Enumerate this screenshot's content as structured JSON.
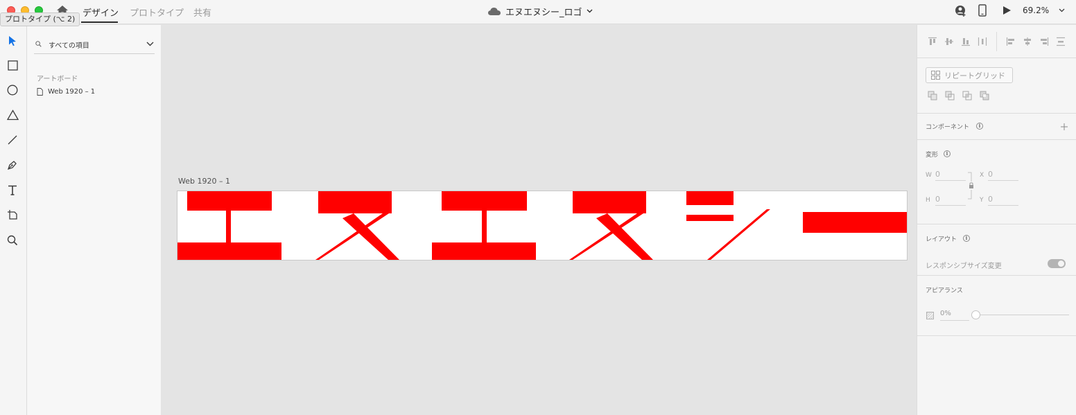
{
  "tooltip": {
    "text": "プロトタイプ (⌥ 2)"
  },
  "header": {
    "tabs": [
      {
        "label": "デザイン",
        "active": true
      },
      {
        "label": "プロトタイプ",
        "active": false
      },
      {
        "label": "共有",
        "active": false
      }
    ],
    "document_title": "エヌエヌシー_ロゴ",
    "zoom": "69.2%"
  },
  "layers": {
    "search_placeholder": "すべての項目",
    "section_title": "アートボード",
    "items": [
      {
        "label": "Web 1920 – 1"
      }
    ]
  },
  "canvas": {
    "artboard_label": "Web 1920 – 1",
    "logo_color": "#ff0000"
  },
  "inspector": {
    "repeat_grid_label": "リピートグリッド",
    "component": {
      "title": "コンポーネント"
    },
    "transform": {
      "title": "変形",
      "w_label": "W",
      "w_value": "0",
      "h_label": "H",
      "h_value": "0",
      "x_label": "X",
      "x_value": "0",
      "y_label": "Y",
      "y_value": "0"
    },
    "layout": {
      "title": "レイアウト",
      "responsive_label": "レスポンシブサイズ変更"
    },
    "appearance": {
      "title": "アピアランス",
      "opacity_value": "0%"
    }
  },
  "colors": {
    "accent": "#1473e6",
    "chrome": "#f5f5f5",
    "canvas": "#e4e4e4"
  }
}
